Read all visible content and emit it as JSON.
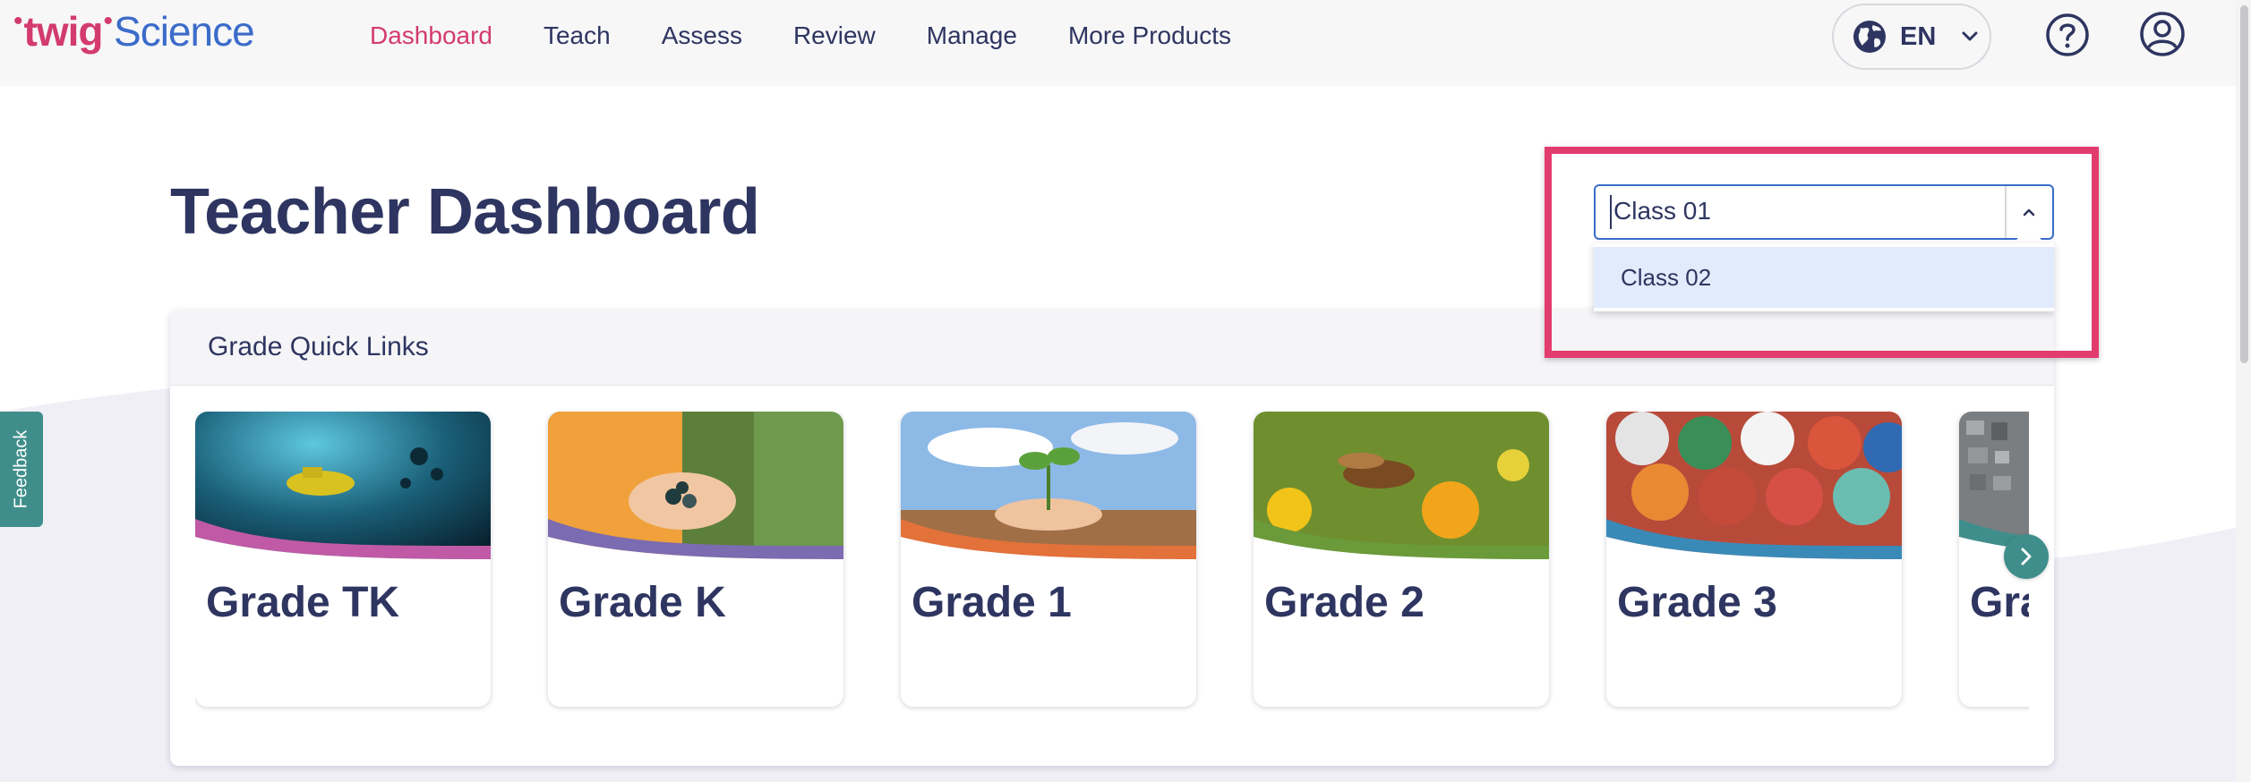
{
  "brand": {
    "logo_twig": "twig",
    "logo_science": "Science",
    "accent": "#d33b6f",
    "primary_text": "#2e3560",
    "teal": "#3f8e8b"
  },
  "nav": {
    "items": [
      {
        "label": "Dashboard",
        "active": true
      },
      {
        "label": "Teach",
        "active": false
      },
      {
        "label": "Assess",
        "active": false
      },
      {
        "label": "Review",
        "active": false
      },
      {
        "label": "Manage",
        "active": false
      },
      {
        "label": "More Products",
        "active": false
      }
    ],
    "language": {
      "code": "EN",
      "icon": "globe-icon"
    },
    "help_icon": "question-circle-icon",
    "account_icon": "user-circle-icon"
  },
  "feedback": {
    "label": "Feedback"
  },
  "page": {
    "title": "Teacher Dashboard"
  },
  "class_selector": {
    "value": "Class 01",
    "options": [
      "Class 02"
    ]
  },
  "grade_links": {
    "heading": "Grade Quick Links",
    "cards": [
      {
        "label": "Grade TK",
        "image": "underwater-submarine",
        "accent": "#c05aa6"
      },
      {
        "label": "Grade K",
        "image": "hands-holding-rocks",
        "accent": "#7b6bb0"
      },
      {
        "label": "Grade 1",
        "image": "hands-holding-seedling",
        "accent": "#e3713a"
      },
      {
        "label": "Grade 2",
        "image": "hummingbird-moth-flowers",
        "accent": "#6a9a3a"
      },
      {
        "label": "Grade 3",
        "image": "pile-of-balls",
        "accent": "#3a8ab8"
      },
      {
        "label": "Gra",
        "image": "city-aerial",
        "accent": "#3f8e8b"
      }
    ],
    "next_icon": "chevron-right-icon"
  }
}
